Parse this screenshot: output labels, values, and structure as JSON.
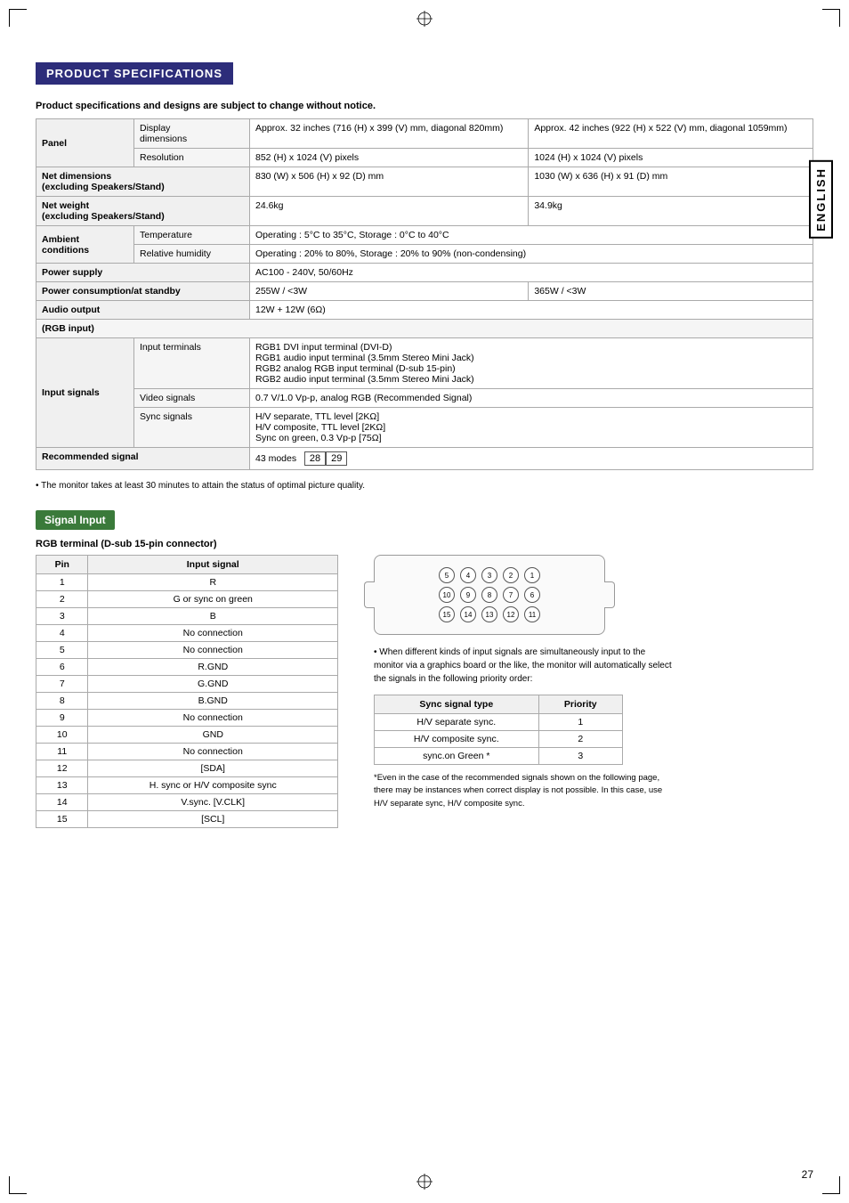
{
  "page": {
    "title": "PRODUCT SPECIFICATIONS",
    "subtitle": "Product specifications and designs are subject to change without notice.",
    "english_label": "ENGLISH",
    "page_number": "27"
  },
  "specs_table": {
    "rows": [
      {
        "main_label": "Panel",
        "sub_label": "Display dimensions",
        "col1": "Approx. 32 inches (716 (H) x 399 (V) mm, diagonal 820mm)",
        "col2": "Approx. 42 inches (922 (H) x 522 (V) mm, diagonal 1059mm)"
      },
      {
        "main_label": "",
        "sub_label": "Resolution",
        "col1": "852 (H) x 1024 (V) pixels",
        "col2": "1024 (H) x 1024 (V) pixels"
      },
      {
        "main_label": "Net dimensions\n(excluding Speakers/Stand)",
        "sub_label": "",
        "col1": "830 (W) x 506 (H) x 92 (D) mm",
        "col2": "1030 (W) x 636 (H) x 91 (D) mm"
      },
      {
        "main_label": "Net weight\n(excluding Speakers/Stand)",
        "sub_label": "",
        "col1": "24.6kg",
        "col2": "34.9kg"
      },
      {
        "main_label": "Ambient conditions",
        "sub_label": "Temperature",
        "col1": "Operating : 5°C to 35°C, Storage : 0°C to 40°C",
        "col2": ""
      },
      {
        "main_label": "",
        "sub_label": "Relative humidity",
        "col1": "Operating : 20% to 80%, Storage : 20% to 90% (non-condensing)",
        "col2": ""
      },
      {
        "main_label": "Power supply",
        "sub_label": "",
        "col1": "AC100 - 240V, 50/60Hz",
        "col2": ""
      },
      {
        "main_label": "Power consumption/at standby",
        "sub_label": "",
        "col1": "255W / <3W",
        "col2": "365W / <3W"
      },
      {
        "main_label": "Audio output",
        "sub_label": "",
        "col1": "12W + 12W (6Ω)",
        "col2": ""
      },
      {
        "main_label": "(RGB input)",
        "sub_label": "",
        "col1": "",
        "col2": ""
      },
      {
        "main_label": "Input signals",
        "sub_label": "Input terminals",
        "col1": "RGB1 DVI input terminal (DVI-D)\nRGB1 audio input terminal (3.5mm Stereo Mini Jack)\nRGB2 analog RGB input terminal (D-sub 15-pin)\nRGB2 audio input terminal (3.5mm Stereo Mini Jack)",
        "col2": ""
      },
      {
        "main_label": "",
        "sub_label": "Video signals",
        "col1": "0.7 V/1.0 Vp-p, analog RGB (Recommended Signal)",
        "col2": ""
      },
      {
        "main_label": "",
        "sub_label": "Sync signals",
        "col1": "H/V separate, TTL level [2KΩ]\nH/V composite, TTL level [2KΩ]\nSync on green, 0.3 Vp-p [75Ω]",
        "col2": ""
      },
      {
        "main_label": "Recommended signal",
        "sub_label": "",
        "col1": "43 modes",
        "col2": "",
        "modes": [
          "28",
          "29"
        ]
      }
    ]
  },
  "signal_input": {
    "section_title": "Signal Input",
    "rgb_subtitle": "RGB terminal (D-sub 15-pin connector)",
    "table_headers": [
      "Pin",
      "Input signal"
    ],
    "pins": [
      {
        "pin": "1",
        "signal": "R"
      },
      {
        "pin": "2",
        "signal": "G or sync on green"
      },
      {
        "pin": "3",
        "signal": "B"
      },
      {
        "pin": "4",
        "signal": "No connection"
      },
      {
        "pin": "5",
        "signal": "No connection"
      },
      {
        "pin": "6",
        "signal": "R.GND"
      },
      {
        "pin": "7",
        "signal": "G.GND"
      },
      {
        "pin": "8",
        "signal": "B.GND"
      },
      {
        "pin": "9",
        "signal": "No connection"
      },
      {
        "pin": "10",
        "signal": "GND"
      },
      {
        "pin": "11",
        "signal": "No connection"
      },
      {
        "pin": "12",
        "signal": "[SDA]"
      },
      {
        "pin": "13",
        "signal": "H. sync or H/V composite sync"
      },
      {
        "pin": "14",
        "signal": "V.sync. [V.CLK]"
      },
      {
        "pin": "15",
        "signal": "[SCL]"
      }
    ],
    "connector": {
      "row1": [
        "5",
        "4",
        "3",
        "2",
        "1"
      ],
      "row2": [
        "10",
        "9",
        "8",
        "7",
        "6"
      ],
      "row3": [
        "15",
        "14",
        "13",
        "12",
        "11"
      ]
    },
    "bullet_note": "• When different kinds of input signals are simultaneously input to the monitor via a graphics board or the like, the monitor will automatically select the signals in the following priority order:",
    "priority_table": {
      "headers": [
        "Sync signal type",
        "Priority"
      ],
      "rows": [
        {
          "type": "H/V separate sync.",
          "priority": "1"
        },
        {
          "type": "H/V composite sync.",
          "priority": "2"
        },
        {
          "type": "sync.on Green *",
          "priority": "3"
        }
      ]
    },
    "footnote": "*Even in the case of the recommended signals shown on the following page, there may be instances when correct display is not possible. In this case, use H/V separate sync, H/V composite sync."
  }
}
